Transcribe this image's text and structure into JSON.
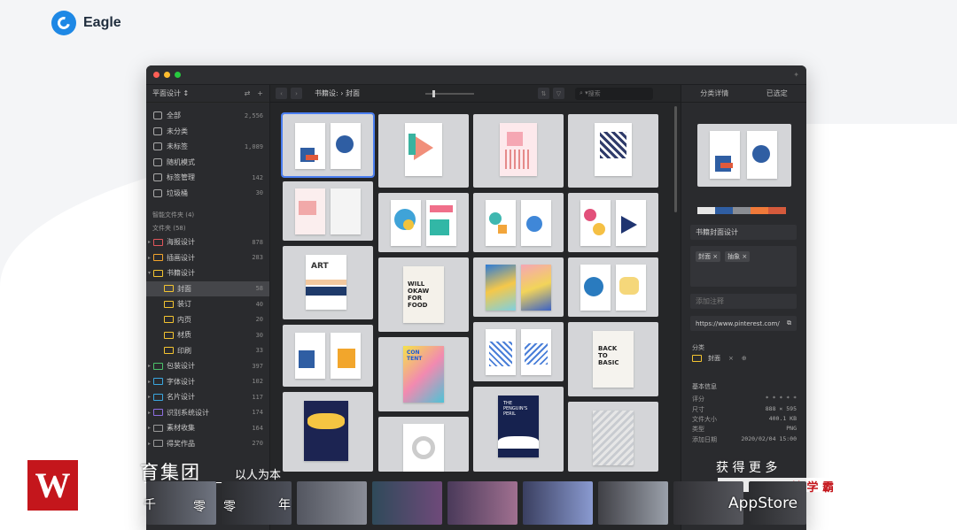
{
  "brand": {
    "name": "Eagle"
  },
  "window": {
    "colors": {
      "close": "#ff5f56",
      "minimize": "#ffbd2e",
      "maximize": "#27c93f"
    }
  },
  "sidebar": {
    "header": "平面设计 ↕",
    "items": [
      {
        "label": "全部",
        "count": "2,556",
        "icon": "all-icon"
      },
      {
        "label": "未分类",
        "count": "",
        "icon": "uncategorized-icon"
      },
      {
        "label": "未标签",
        "count": "1,089",
        "icon": "untagged-icon"
      },
      {
        "label": "随机模式",
        "count": "",
        "icon": "random-icon"
      },
      {
        "label": "标签管理",
        "count": "142",
        "icon": "tag-icon"
      },
      {
        "label": "垃圾桶",
        "count": "30",
        "icon": "trash-icon"
      }
    ],
    "smart_folders": "智能文件夹 (4)",
    "folders_header": "文件夹 (58)",
    "folders": [
      {
        "label": "海报设计",
        "count": "878",
        "color": "#e0565b"
      },
      {
        "label": "插画设计",
        "count": "283",
        "color": "#f4a52c"
      },
      {
        "label": "书籍设计",
        "count": "",
        "color": "#f4c430"
      },
      {
        "label": "封面",
        "count": "58",
        "color": "#f4c430",
        "sub": true
      },
      {
        "label": "装订",
        "count": "40",
        "color": "#f4c430",
        "sub": true
      },
      {
        "label": "内页",
        "count": "20",
        "color": "#f4c430",
        "sub": true
      },
      {
        "label": "材质",
        "count": "30",
        "color": "#f4c430",
        "sub": true
      },
      {
        "label": "印刷",
        "count": "33",
        "color": "#f4c430",
        "sub": true
      },
      {
        "label": "包装设计",
        "count": "397",
        "color": "#4bc26a"
      },
      {
        "label": "字体设计",
        "count": "102",
        "color": "#3aa7e0"
      },
      {
        "label": "名片设计",
        "count": "117",
        "color": "#3aa7e0"
      },
      {
        "label": "识别系统设计",
        "count": "174",
        "color": "#8e6ee0"
      },
      {
        "label": "素材收集",
        "count": "164",
        "color": "#999999"
      },
      {
        "label": "得奖作品",
        "count": "270",
        "color": "#999999"
      }
    ]
  },
  "toolbar": {
    "crumb_parent": "书籍设:",
    "crumb_current": "封面",
    "search_placeholder": "搜索"
  },
  "inspector": {
    "tab_left": "分类详情",
    "tab_right": "已选定",
    "palette": [
      "#e6e6e6",
      "#2f5ea3",
      "#8a8d93",
      "#f07a3a",
      "#d55a3c"
    ],
    "name": "书籍封面设计",
    "tags": [
      "封面 ×",
      "抽象 ×"
    ],
    "note_placeholder": "添加注释",
    "url": "https://www.pinterest.com/",
    "category_label": "分类",
    "category_tag": "封面",
    "basic_info": "基本信息",
    "rating_label": "评分",
    "rating_value": "* * * * *",
    "size_label": "尺寸",
    "size_value": "888 × 595",
    "filesize_label": "文件大小",
    "filesize_value": "400.1 KB",
    "type_label": "类型",
    "type_value": "PNG",
    "date_label": "添加日期",
    "date_value": "2020/02/04 15:00"
  },
  "overlay": {
    "group_text": "育集团",
    "slogan": "以人为本",
    "more": "获 得 更 多",
    "hui": "绘 学 霸",
    "appstore": "AppStore",
    "bottom_chars": [
      "千",
      "零",
      "零",
      "年"
    ],
    "logo_letter": "W"
  }
}
